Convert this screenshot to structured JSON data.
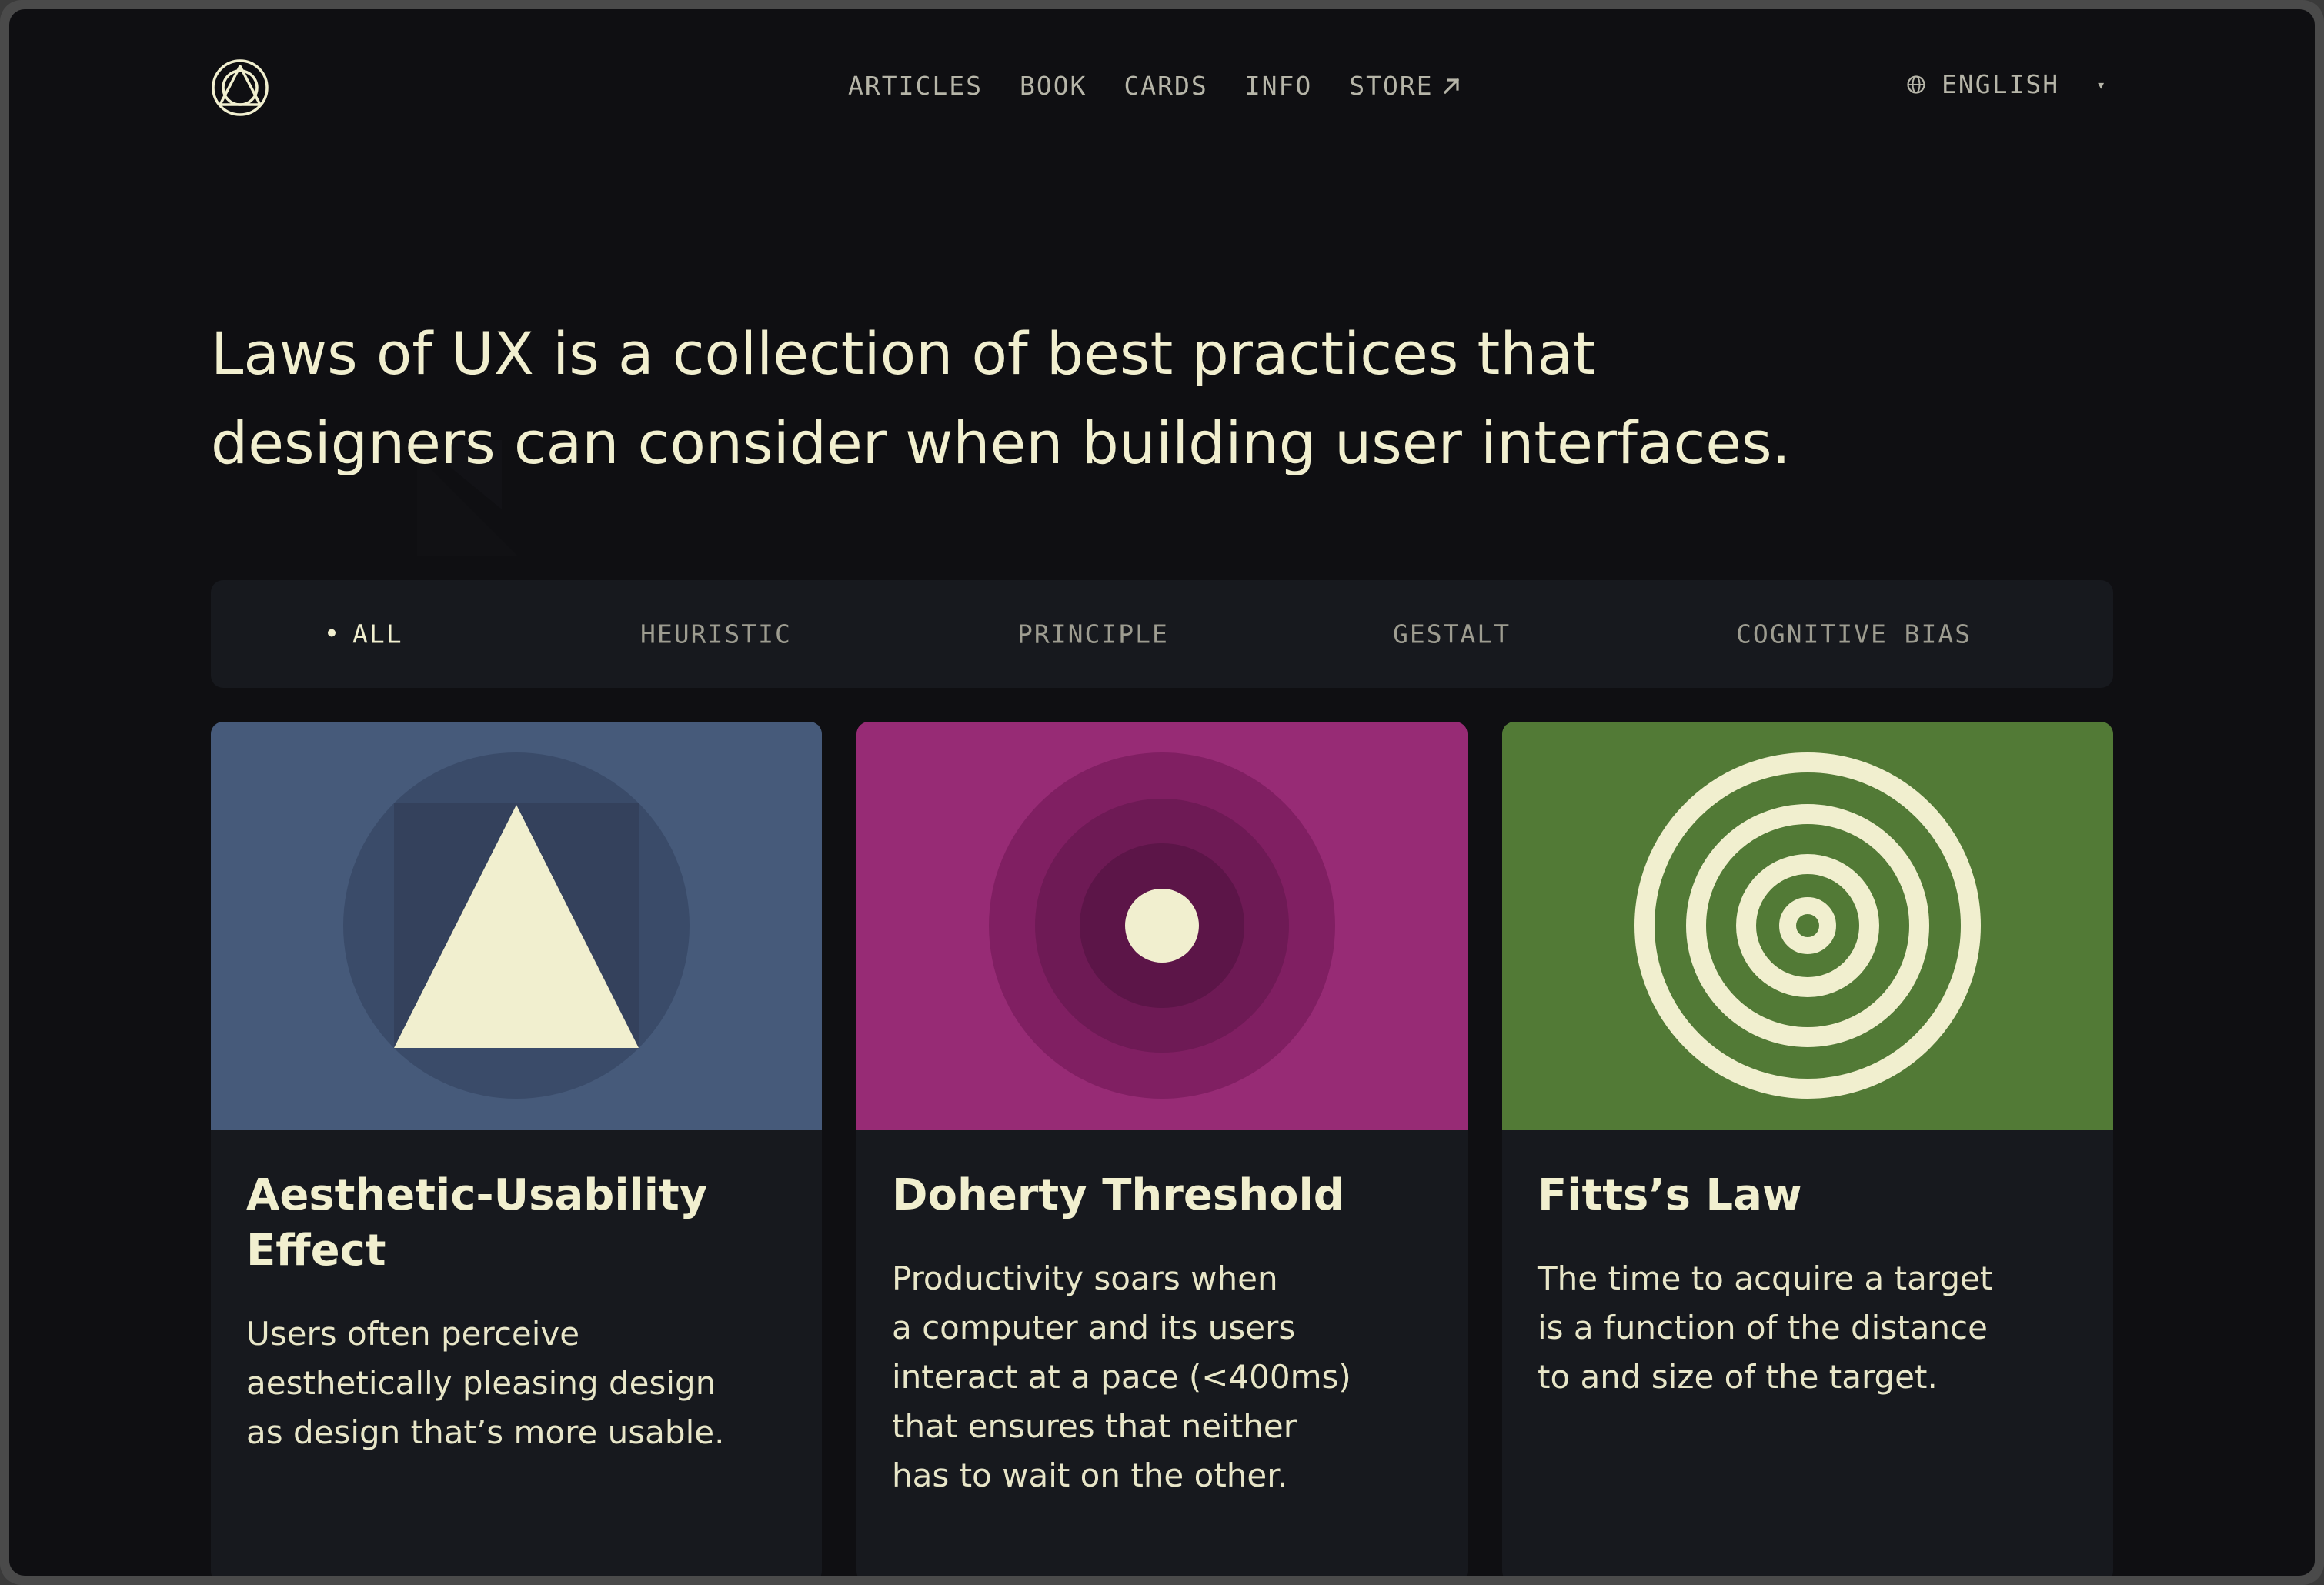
{
  "colors": {
    "background": "#0f0f12",
    "text": "#f1efcf",
    "nav_text": "#b6b5a8",
    "filter_bar": "#17191e",
    "card_bg": "#17191e",
    "card1_art": "#465a7a",
    "card2_art": "#972b75",
    "card3_art": "#527a36"
  },
  "header": {
    "logo_icon": "laws-of-ux-logo-icon",
    "nav": [
      {
        "label": "ARTICLES"
      },
      {
        "label": "BOOK"
      },
      {
        "label": "CARDS"
      },
      {
        "label": "INFO"
      },
      {
        "label": "STORE",
        "icon": "external-arrow-icon"
      }
    ],
    "language": {
      "icon": "globe-icon",
      "label": "ENGLISH",
      "caret_icon": "caret-down-icon"
    }
  },
  "hero": {
    "line1": "Laws of UX is a collection of best practices that",
    "line2": "designers can consider when building user interfaces."
  },
  "filters": [
    {
      "label": "ALL",
      "active": true
    },
    {
      "label": "HEURISTIC",
      "active": false
    },
    {
      "label": "PRINCIPLE",
      "active": false
    },
    {
      "label": "GESTALT",
      "active": false
    },
    {
      "label": "COGNITIVE BIAS",
      "active": false
    }
  ],
  "cards": [
    {
      "title_line1": "Aesthetic-Usability",
      "title_line2": "Effect",
      "desc": [
        "Users often perceive",
        "aesthetically pleasing design",
        "as design that’s more usable."
      ]
    },
    {
      "title_line1": "Doherty Threshold",
      "desc": [
        "Productivity soars when",
        "a computer and its users",
        "interact at a pace (<400ms)",
        "that ensures that neither",
        "has to wait on the other."
      ]
    },
    {
      "title_line1": "Fitts’s Law",
      "desc": [
        "The time to acquire a target",
        "is a function of the distance",
        "to and size of the target."
      ]
    }
  ]
}
